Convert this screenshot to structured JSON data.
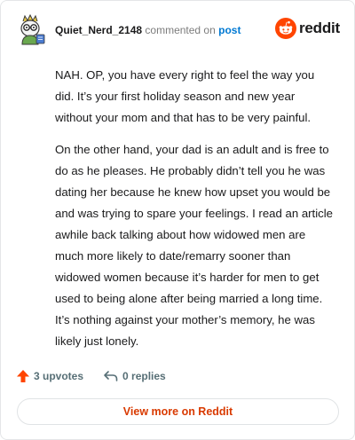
{
  "comment": {
    "username": "Quiet_Nerd_2148",
    "action_text": "commented on",
    "post_link": "post",
    "paragraphs": [
      "NAH. OP, you have every right to feel the way you did. It’s your first holiday season and new year without your mom and that has to be very painful.",
      "On the other hand, your dad is an adult and is free to do as he pleases. He probably didn’t tell you he was dating her because he knew how upset you would be and was trying to spare your feelings. I read an article awhile back talking about how widowed men are much more likely to date/remarry sooner than widowed women because it’s harder for men to get used to being alone after being married a long time. It’s nothing against your mother’s memory, he was likely just lonely."
    ]
  },
  "brand": {
    "wordmark": "reddit",
    "icon": "reddit-snoo-icon"
  },
  "actions": {
    "upvotes": "3 upvotes",
    "upvote_icon": "upvote-arrow-icon",
    "replies": "0 replies",
    "reply_icon": "reply-arrow-icon"
  },
  "footer": {
    "view_more": "View more on Reddit"
  },
  "colors": {
    "reddit_orange": "#ff4500",
    "link_blue": "#0079d3",
    "view_more_text": "#d93a00",
    "muted": "#576f76"
  }
}
